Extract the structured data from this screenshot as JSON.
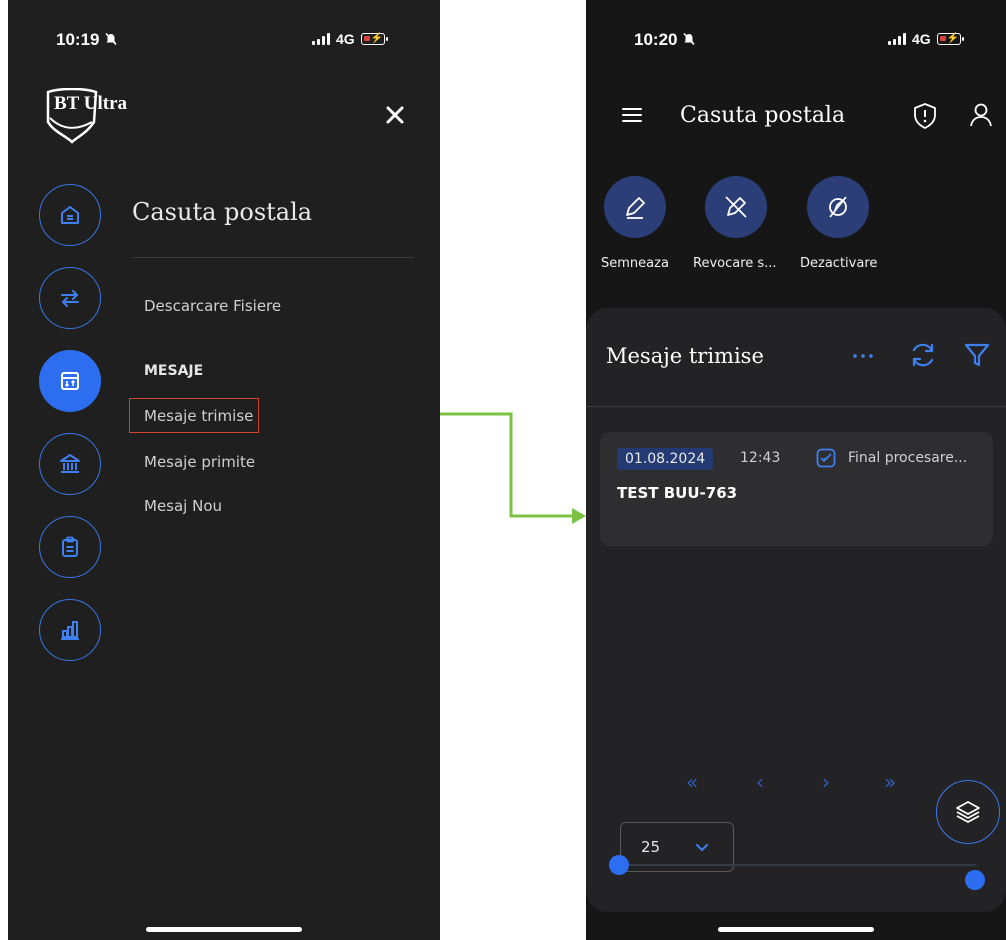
{
  "left_screen": {
    "status": {
      "time": "10:19",
      "network": "4G"
    },
    "logo_text": "BT Ultra",
    "menu_title": "Casuta postala",
    "links": {
      "descarcare": "Descarcare Fisiere",
      "section_label": "MESAJE",
      "trimise": "Mesaje trimise",
      "primite": "Mesaje primite",
      "nou": "Mesaj Nou"
    },
    "rail_icons": [
      "home-icon",
      "transfer-icon",
      "mailbox-icon",
      "bank-icon",
      "clipboard-icon",
      "chart-icon"
    ]
  },
  "right_screen": {
    "status": {
      "time": "10:20",
      "network": "4G"
    },
    "header_title": "Casuta postala",
    "actions": {
      "semneaza": "Semneaza",
      "revocare": "Revocare s...",
      "dezactivare": "Dezactivare"
    },
    "sheet_title": "Mesaje trimise",
    "message": {
      "date": "01.08.2024",
      "time": "12:43",
      "status": "Final procesare...",
      "title": "TEST BUU-763"
    },
    "pager": {
      "first": "«",
      "prev": "‹",
      "next": "›",
      "last": "»"
    },
    "per_page": "25"
  },
  "colors": {
    "accent": "#2d6ef0",
    "highlight": "#d1452e",
    "arrow": "#7cc242",
    "chip": "#243a73"
  }
}
